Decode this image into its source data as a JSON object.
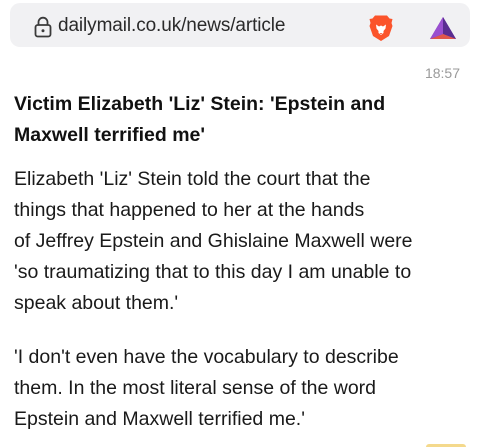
{
  "browser": {
    "url": "dailymail.co.uk/news/article",
    "icons": {
      "lock": "lock-icon",
      "brave": "brave-lion-icon",
      "rewards": "brave-rewards-triangle-icon"
    },
    "colors": {
      "bar_bg": "#f1f1f3",
      "brave_orange": "#fb542b",
      "rewards_purple": "#6b3fa0"
    }
  },
  "article": {
    "timestamp": "18:57",
    "headline_lines": [
      "Victim Elizabeth 'Liz' Stein: 'Epstein and",
      "Maxwell terrified me'"
    ],
    "paragraphs": [
      {
        "lines": [
          "Elizabeth 'Liz' Stein told the court that the",
          "things that happened to her at the hands",
          "of  Jeffrey Epstein and Ghislaine Maxwell were",
          "'so traumatizing that to this day I am unable to",
          "speak about them.'"
        ]
      },
      {
        "lines": [
          "'I don't even have the vocabulary to describe",
          "them. In the most literal sense of the word",
          "Epstein and Maxwell terrified me.'"
        ]
      }
    ]
  }
}
